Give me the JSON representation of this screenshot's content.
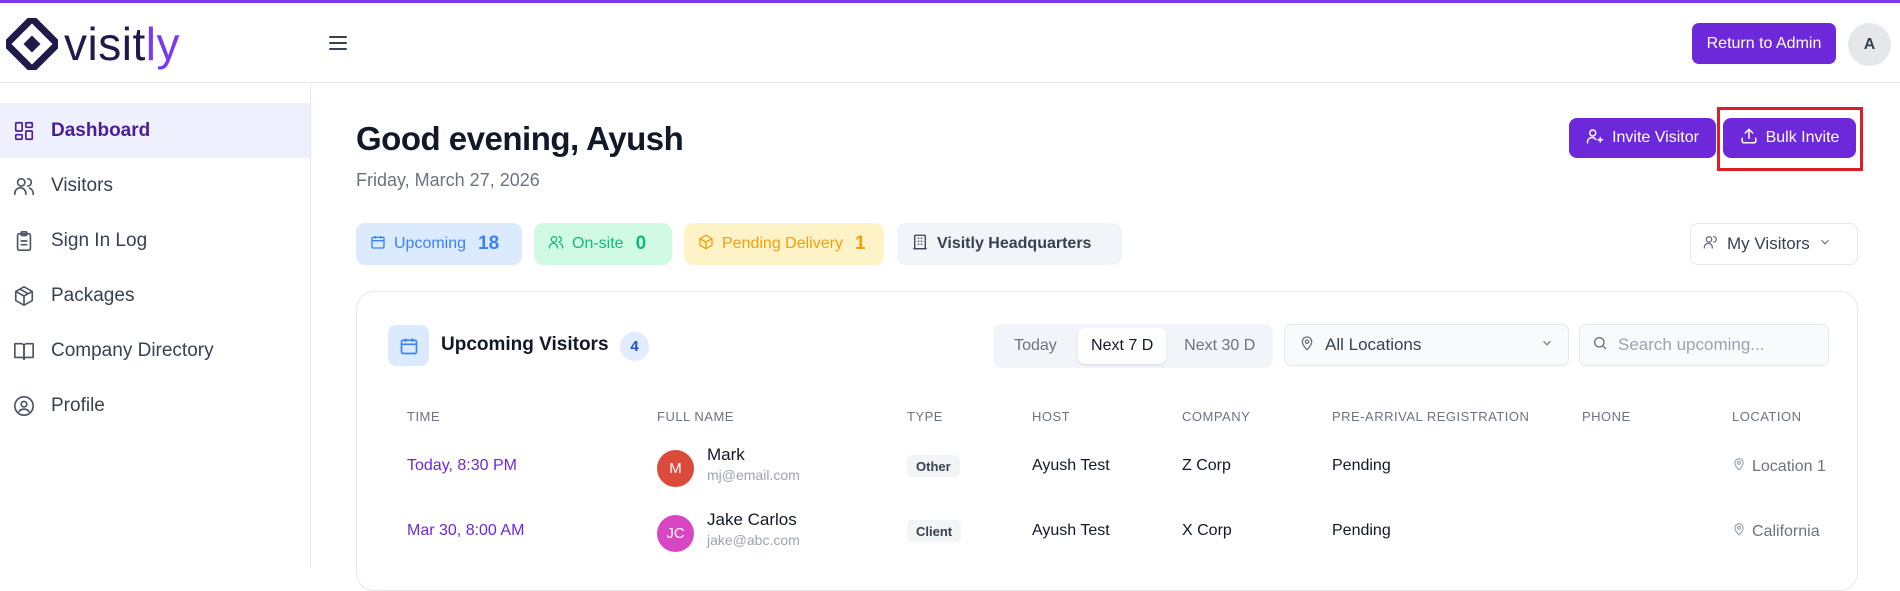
{
  "app": {
    "logo_text_main": "visit",
    "logo_text_accent": "ly"
  },
  "header": {
    "return_button": "Return to Admin",
    "avatar_initial": "A"
  },
  "sidebar": {
    "items": [
      {
        "label": "Dashboard",
        "icon": "dashboard-icon",
        "active": true
      },
      {
        "label": "Visitors",
        "icon": "users-icon"
      },
      {
        "label": "Sign In Log",
        "icon": "clipboard-icon"
      },
      {
        "label": "Packages",
        "icon": "package-icon"
      },
      {
        "label": "Company Directory",
        "icon": "book-icon"
      },
      {
        "label": "Profile",
        "icon": "user-circle-icon"
      }
    ]
  },
  "main": {
    "greeting": "Good evening, Ayush",
    "date": "Friday, March 27, 2026",
    "invite_visitor": "Invite Visitor",
    "bulk_invite": "Bulk Invite",
    "chips": {
      "upcoming_label": "Upcoming",
      "upcoming_count": "18",
      "onsite_label": "On-site",
      "onsite_count": "0",
      "pending_label": "Pending Delivery",
      "pending_count": "1",
      "location_label": "Visitly Headquarters"
    },
    "my_visitors": "My Visitors"
  },
  "card": {
    "title": "Upcoming Visitors",
    "count": "4",
    "ranges": [
      "Today",
      "Next 7 D",
      "Next 30 D"
    ],
    "active_range": "Next 7 D",
    "location_select": "All Locations",
    "search_placeholder": "Search upcoming...",
    "columns": [
      "TIME",
      "FULL NAME",
      "TYPE",
      "HOST",
      "COMPANY",
      "PRE-ARRIVAL REGISTRATION",
      "PHONE",
      "LOCATION"
    ],
    "rows": [
      {
        "time": "Today, 8:30 PM",
        "initials": "M",
        "avatar_color": "#dc4a3c",
        "name": "Mark",
        "email": "mj@email.com",
        "type": "Other",
        "host": "Ayush Test",
        "company": "Z Corp",
        "registration": "Pending",
        "phone": "",
        "location": "Location 1"
      },
      {
        "time": "Mar 30, 8:00 AM",
        "initials": "JC",
        "avatar_color": "#d946c4",
        "name": "Jake Carlos",
        "email": "jake@abc.com",
        "type": "Client",
        "host": "Ayush Test",
        "company": "X Corp",
        "registration": "Pending",
        "phone": "",
        "location": "California"
      }
    ]
  },
  "colors": {
    "brand": "#6d28d9",
    "highlight": "#e11d24"
  }
}
